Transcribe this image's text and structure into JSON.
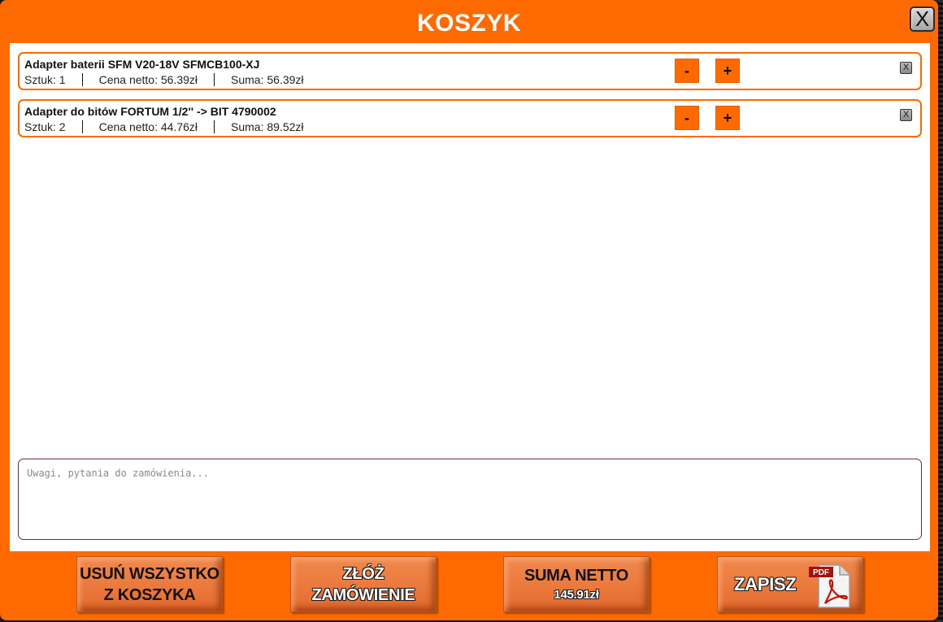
{
  "modal": {
    "title": "KOSZYK",
    "close_label": "X"
  },
  "cart": {
    "items": [
      {
        "name": "Adapter baterii SFM V20-18V SFMCB100-XJ",
        "quantity_text": "Sztuk: 1",
        "net_price_text": "Cena netto: 56.39zł",
        "sum_text": "Suma: 56.39zł",
        "minus_label": "-",
        "plus_label": "+",
        "remove_label": "X"
      },
      {
        "name": "Adapter do bitów FORTUM 1/2'' -> BIT 4790002",
        "quantity_text": "Sztuk: 2",
        "net_price_text": "Cena netto: 44.76zł",
        "sum_text": "Suma: 89.52zł",
        "minus_label": "-",
        "plus_label": "+",
        "remove_label": "X"
      }
    ]
  },
  "notes": {
    "placeholder": "Uwagi, pytania do zamówienia..."
  },
  "footer": {
    "clear_line1": "USUŃ WSZYSTKO",
    "clear_line2": "Z KOSZYKA",
    "order_line1": "ZŁÓŻ",
    "order_line2": "ZAMÓWIENIE",
    "sum_label": "SUMA  NETTO",
    "sum_value": "145.91zł",
    "save_label": "ZAPISZ",
    "pdf_badge": "PDF"
  },
  "colors": {
    "accent": "#ff6a00",
    "pdf_red": "#b30b00"
  },
  "icons": {
    "close": "close-icon",
    "pdf": "pdf-file-icon"
  }
}
